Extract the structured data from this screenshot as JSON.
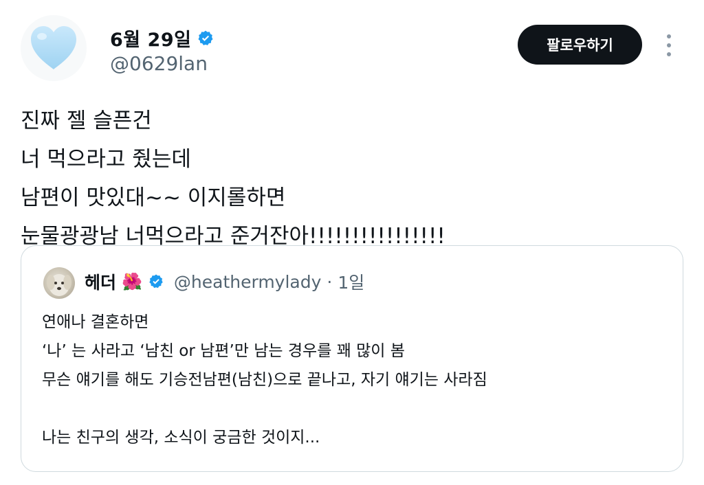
{
  "author": {
    "display_name": "6월 29일",
    "handle": "@0629lan",
    "avatar_icon": "light-blue-heart-icon",
    "verified": true
  },
  "actions": {
    "follow_label": "팔로우하기",
    "more_icon": "more-vertical-icon"
  },
  "tweet": {
    "lines": [
      "진짜 젤 슬픈건",
      "너 먹으라고 줬는데",
      "남편이 맛있대~~ 이지롤하면",
      "눈물광광남 너먹으라고 준거잔아!!!!!!!!!!!!!!!!"
    ]
  },
  "quote": {
    "display_name": "헤더",
    "name_emoji": "🌺",
    "handle": "@heathermylady",
    "separator": "·",
    "time": "1일",
    "lines": [
      "연애나 결혼하면",
      "‘나’ 는 사라고 ‘남친 or 남편’만 남는 경우를 꽤 많이 봄",
      "무슨 얘기를 해도 기승전남편(남친)으로 끝나고, 자기 얘기는 사라짐",
      "",
      "나는 친구의 생각, 소식이 궁금한 것이지..."
    ]
  },
  "colors": {
    "verified_blue": "#1d9bf0",
    "heart_light_blue": "#b3dcf5",
    "follow_button_bg": "#0f1419",
    "secondary_text": "#536471",
    "card_border": "#cfd9de"
  }
}
